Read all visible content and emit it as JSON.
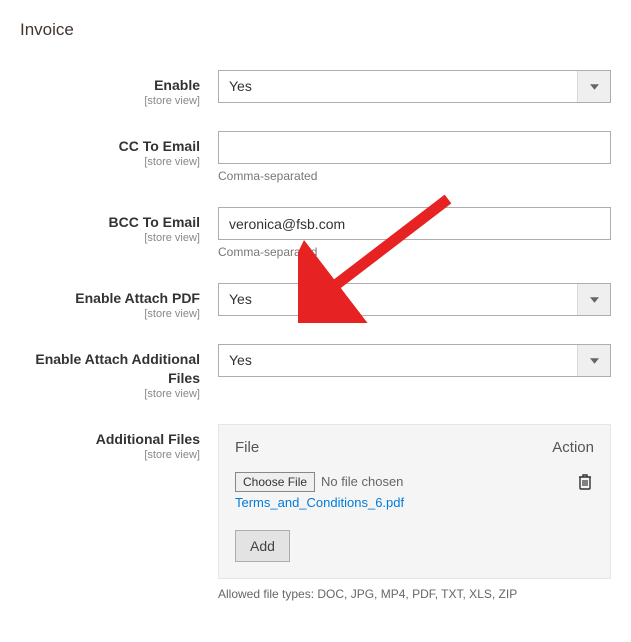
{
  "section": {
    "title": "Invoice"
  },
  "fields": {
    "enable": {
      "label": "Enable",
      "scope": "[store view]",
      "value": "Yes"
    },
    "cc": {
      "label": "CC To Email",
      "scope": "[store view]",
      "value": "",
      "helper": "Comma-separated"
    },
    "bcc": {
      "label": "BCC To Email",
      "scope": "[store view]",
      "value": "veronica@fsb.com",
      "helper": "Comma-separated"
    },
    "attach_pdf": {
      "label": "Enable Attach PDF",
      "scope": "[store view]",
      "value": "Yes"
    },
    "attach_additional": {
      "label": "Enable Attach Additional Files",
      "scope": "[store view]",
      "value": "Yes"
    },
    "additional_files": {
      "label": "Additional Files",
      "scope": "[store view]",
      "col_file": "File",
      "col_action": "Action",
      "choose_label": "Choose File",
      "no_file": "No file chosen",
      "filename": "Terms_and_Conditions_6.pdf",
      "add_label": "Add",
      "allowed": "Allowed file types: DOC, JPG, MP4, PDF, TXT, XLS, ZIP"
    }
  }
}
